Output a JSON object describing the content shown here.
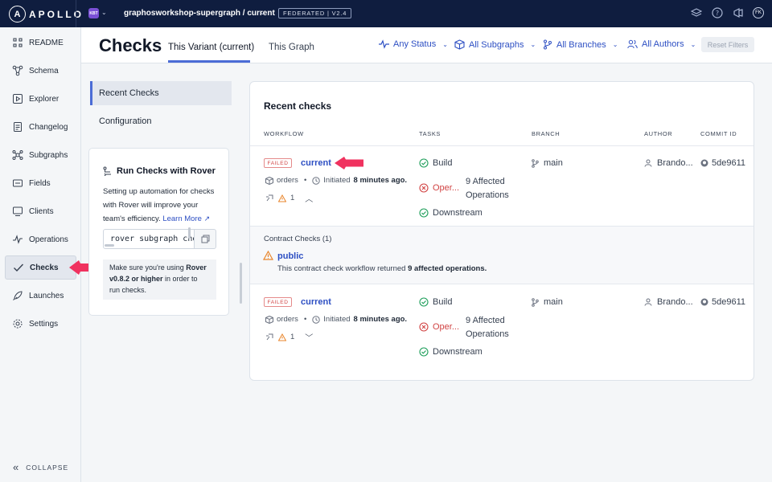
{
  "topbar": {
    "logo_text": "APOLLO",
    "logo_letter": "A",
    "org_badge": "KBT",
    "graph_name": "graphosworkshop-supergraph / current",
    "federated_badge": "FEDERATED | V2.4",
    "avatar_initials": "FK"
  },
  "sidebar": {
    "items": [
      {
        "label": "README",
        "icon": "readme-icon"
      },
      {
        "label": "Schema",
        "icon": "schema-icon"
      },
      {
        "label": "Explorer",
        "icon": "explorer-icon"
      },
      {
        "label": "Changelog",
        "icon": "changelog-icon"
      },
      {
        "label": "Subgraphs",
        "icon": "subgraphs-icon"
      },
      {
        "label": "Fields",
        "icon": "fields-icon"
      },
      {
        "label": "Clients",
        "icon": "clients-icon"
      },
      {
        "label": "Operations",
        "icon": "operations-icon"
      },
      {
        "label": "Checks",
        "icon": "checks-icon",
        "active": true
      },
      {
        "label": "Launches",
        "icon": "launches-icon"
      },
      {
        "label": "Settings",
        "icon": "settings-icon"
      }
    ],
    "collapse_label": "COLLAPSE"
  },
  "header": {
    "title": "Checks",
    "tabs": [
      "This Variant (current)",
      "This Graph"
    ],
    "filters": [
      "Any Status",
      "All Subgraphs",
      "All Branches",
      "All Authors"
    ],
    "reset_label": "Reset Filters"
  },
  "subnav": {
    "items": [
      "Recent Checks",
      "Configuration"
    ]
  },
  "rover": {
    "title": "Run Checks with Rover",
    "desc": "Setting up automation for checks with Rover will improve your team's efficiency.",
    "link": "Learn More",
    "command": "rover subgraph check",
    "note_prefix": "Make sure you're using ",
    "note_bold": "Rover v0.8.2 or higher",
    "note_suffix": " in order to run checks."
  },
  "checks": {
    "title": "Recent checks",
    "columns": [
      "WORKFLOW",
      "TASKS",
      "BRANCH",
      "AUTHOR",
      "COMMIT ID"
    ],
    "rows": [
      {
        "status": "FAILED",
        "workflow": "current",
        "subgraph": "orders",
        "initiated_prefix": "Initiated",
        "time": "8 minutes ago.",
        "warnings": "1",
        "tasks": {
          "build": "Build",
          "operations": "Oper...",
          "operations_detail": "9 Affected Operations",
          "downstream": "Downstream"
        },
        "branch": "main",
        "author": "Brando...",
        "commit": "5de9611"
      },
      {
        "status": "FAILED",
        "workflow": "current",
        "subgraph": "orders",
        "initiated_prefix": "Initiated",
        "time": "8 minutes ago.",
        "warnings": "1",
        "tasks": {
          "build": "Build",
          "operations": "Oper...",
          "operations_detail": "9 Affected Operations",
          "downstream": "Downstream"
        },
        "branch": "main",
        "author": "Brando...",
        "commit": "5de9611"
      }
    ],
    "contract": {
      "title": "Contract Checks (1)",
      "name": "public",
      "desc_prefix": "This contract check workflow returned ",
      "desc_bold": "9 affected operations."
    }
  },
  "colors": {
    "topbar": "#0f1d3f",
    "link_blue": "#2d4fc3",
    "fail_red": "#d14343",
    "pass_green": "#1e9e5a",
    "warn_orange": "#e8852b",
    "annotation_pink": "#f0325f"
  }
}
